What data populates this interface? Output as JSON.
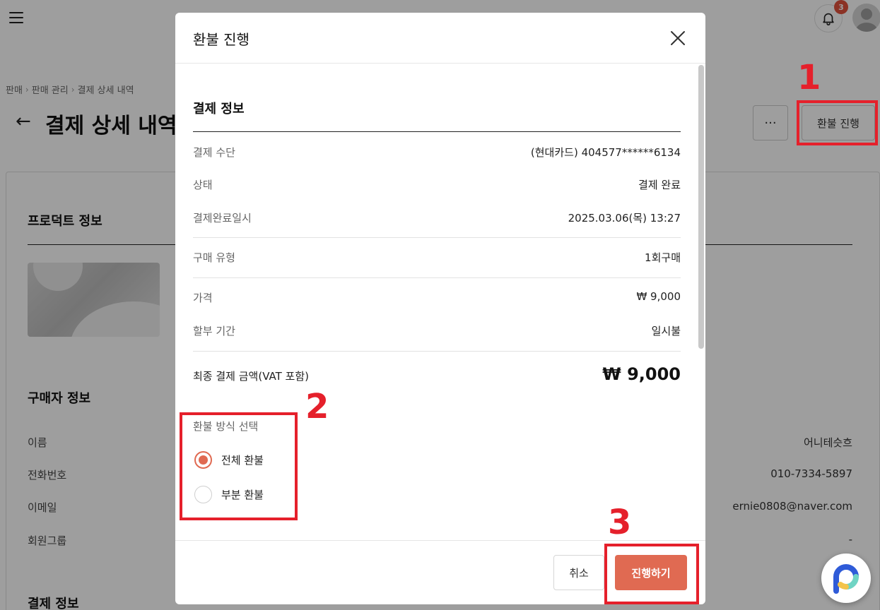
{
  "header": {
    "notification_count": "3"
  },
  "breadcrumb": [
    "판매",
    "판매 관리",
    "결제 상세 내역"
  ],
  "page": {
    "title": "결제 상세 내역",
    "more_label": "···",
    "refund_label": "환불 진행"
  },
  "background": {
    "product_section_title": "프로덕트 정보",
    "buyer_section_title": "구매자 정보",
    "buyer": {
      "rows": [
        {
          "label": "이름",
          "value": "어니테슷흐"
        },
        {
          "label": "전화번호",
          "value": "010-7334-5897"
        },
        {
          "label": "이메일",
          "value": "ernie0808@naver.com"
        },
        {
          "label": "회원그룹",
          "value": "-"
        }
      ]
    },
    "payment_section_title": "결제 정보"
  },
  "modal": {
    "title": "환불 진행",
    "section_title": "결제 정보",
    "rows": [
      {
        "label": "결제 수단",
        "value": "(현대카드) 404577******6134"
      },
      {
        "label": "상태",
        "value": "결제 완료"
      },
      {
        "label": "결제완료일시",
        "value": "2025.03.06(목) 13:27"
      },
      {
        "label": "구매 유형",
        "value": "1회구매"
      },
      {
        "label": "가격",
        "value": "₩ 9,000"
      },
      {
        "label": "할부 기간",
        "value": "일시불"
      }
    ],
    "total": {
      "label": "최종 결제 금액(VAT 포함)",
      "value": "₩ 9,000"
    },
    "refund_method": {
      "label": "환불 방식 선택",
      "options": [
        {
          "label": "전체 환불",
          "selected": true
        },
        {
          "label": "부분 환불",
          "selected": false
        }
      ]
    },
    "cancel_label": "취소",
    "proceed_label": "진행하기"
  },
  "annotations": [
    "1",
    "2",
    "3"
  ],
  "colors": {
    "accent": "#e06a52",
    "annotation": "#e5202b",
    "badge": "#e0513c"
  }
}
